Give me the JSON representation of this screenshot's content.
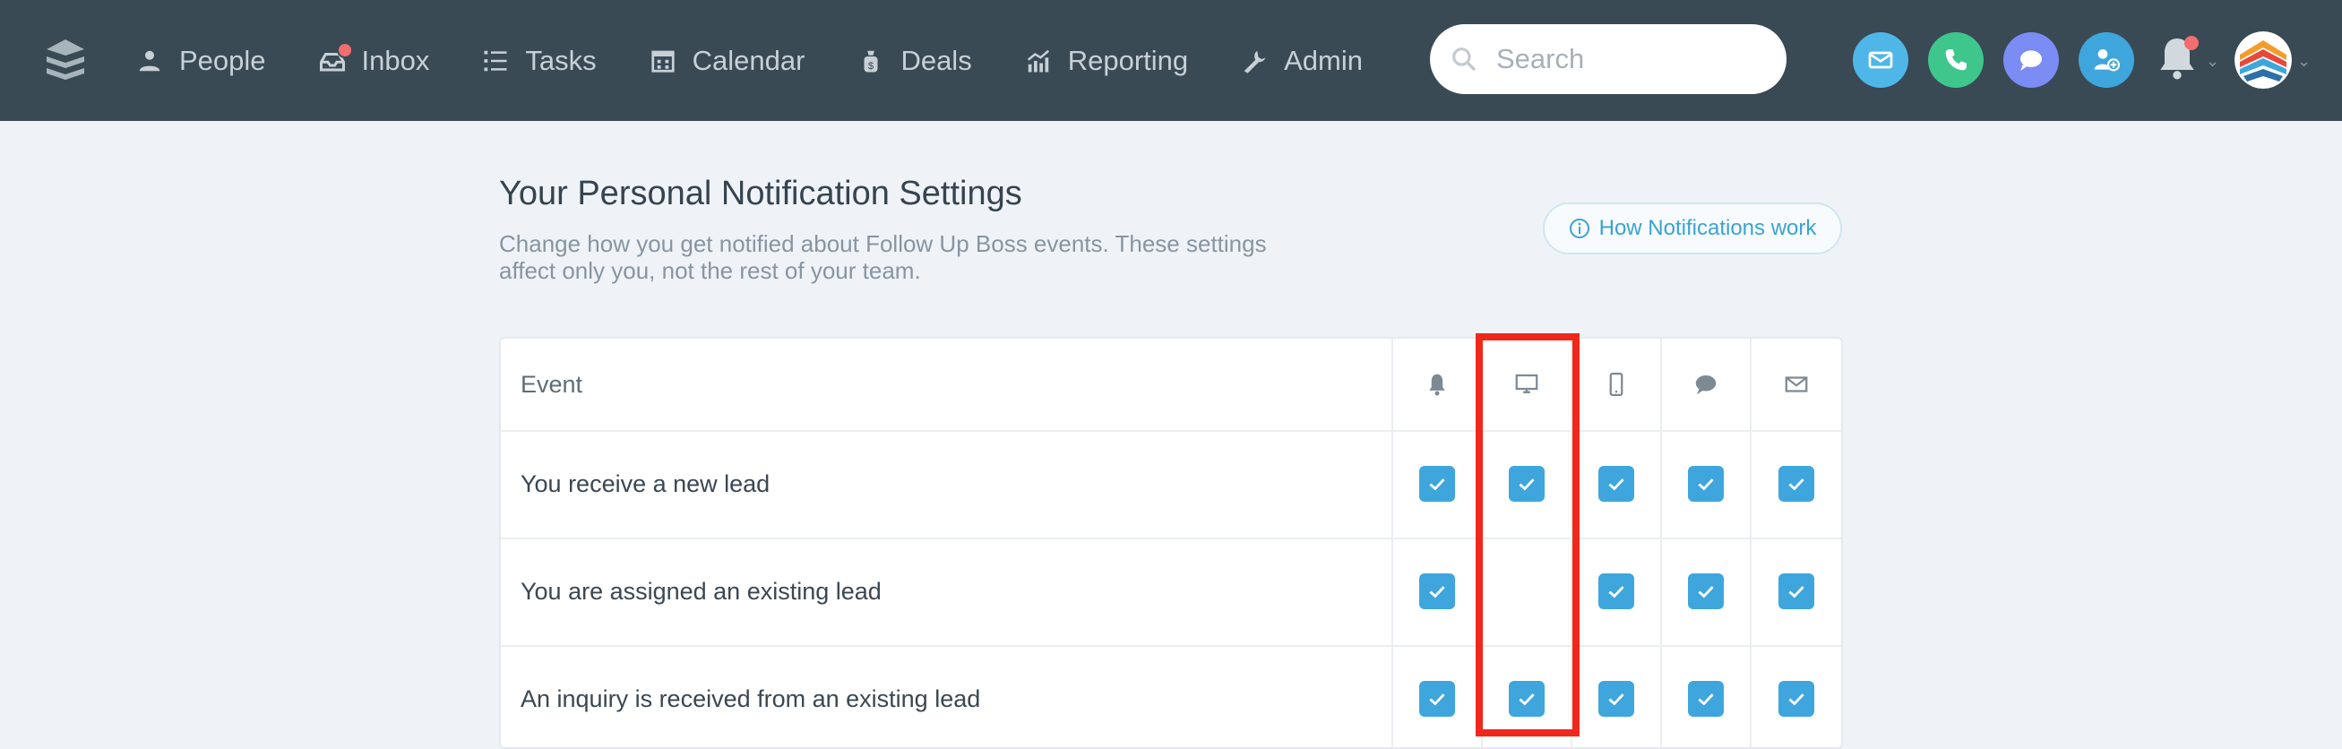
{
  "nav": {
    "items": [
      {
        "label": "People",
        "icon": "person-icon"
      },
      {
        "label": "Inbox",
        "icon": "inbox-icon",
        "badge": true
      },
      {
        "label": "Tasks",
        "icon": "tasks-list-icon"
      },
      {
        "label": "Calendar",
        "icon": "calendar-icon"
      },
      {
        "label": "Deals",
        "icon": "deals-bag-icon"
      },
      {
        "label": "Reporting",
        "icon": "reporting-chart-icon"
      },
      {
        "label": "Admin",
        "icon": "wrench-icon"
      }
    ],
    "search_placeholder": "Search",
    "actions": [
      {
        "icon": "email-icon",
        "color": "#4fb7e8"
      },
      {
        "icon": "phone-icon",
        "color": "#3fc68c"
      },
      {
        "icon": "chat-icon",
        "color": "#7b8cf5"
      },
      {
        "icon": "add-contact-icon",
        "color": "#3ea6dc"
      }
    ]
  },
  "page": {
    "title": "Your Personal Notification Settings",
    "description": "Change how you get notified about Follow Up Boss events. These settings affect only you, not the rest of your team.",
    "how_button": "How Notifications work"
  },
  "table": {
    "event_header": "Event",
    "channels": [
      "bell-icon",
      "desktop-icon",
      "mobile-icon",
      "chat-bubble-icon",
      "envelope-icon"
    ],
    "rows": [
      {
        "event": "You receive a new lead",
        "checked": [
          true,
          true,
          true,
          true,
          true
        ]
      },
      {
        "event": "You are assigned an existing lead",
        "checked": [
          true,
          false,
          true,
          true,
          true
        ]
      },
      {
        "event": "An inquiry is received from an existing lead",
        "checked": [
          true,
          true,
          true,
          true,
          true
        ]
      }
    ]
  },
  "colors": {
    "nav_bg": "#394a55",
    "accent": "#3ea6dc",
    "highlight": "#f0281c",
    "badge": "#f26d6d"
  }
}
